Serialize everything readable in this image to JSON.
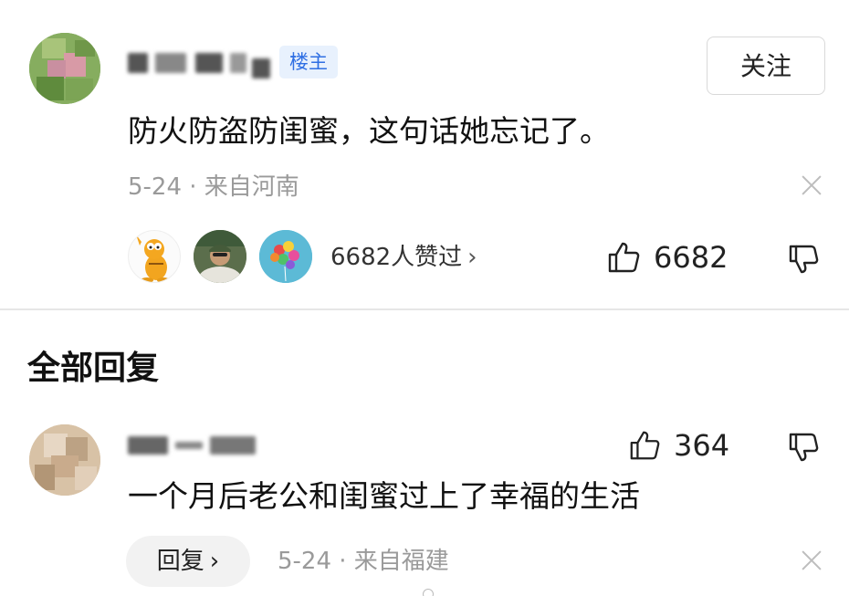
{
  "top_comment": {
    "avatar": "blurred-avatar",
    "username": "",
    "author_badge": "楼主",
    "follow_label": "关注",
    "text": "防火防盗防闺蜜，这句话她忘记了。",
    "meta": "5-24 · 来自河南",
    "likers": [
      "garfield-avatar",
      "man-in-cap-avatar",
      "balloons-avatar"
    ],
    "likes_summary": "6682人赞过",
    "like_count": "6682"
  },
  "section_title": "全部回复",
  "reply": {
    "avatar": "blurred-avatar",
    "username": "",
    "like_count": "364",
    "text": "一个月后老公和闺蜜过上了幸福的生活",
    "reply_label": "回复",
    "meta": "5-24 · 来自福建"
  },
  "icons": {
    "like": "thumbs-up-icon",
    "dislike": "thumbs-down-icon",
    "close": "close-icon",
    "chevron": "chevron-right-icon"
  },
  "colors": {
    "badge_text": "#2f6fe3",
    "badge_bg": "#e8f1fd",
    "meta_text": "#9a9a9a"
  }
}
